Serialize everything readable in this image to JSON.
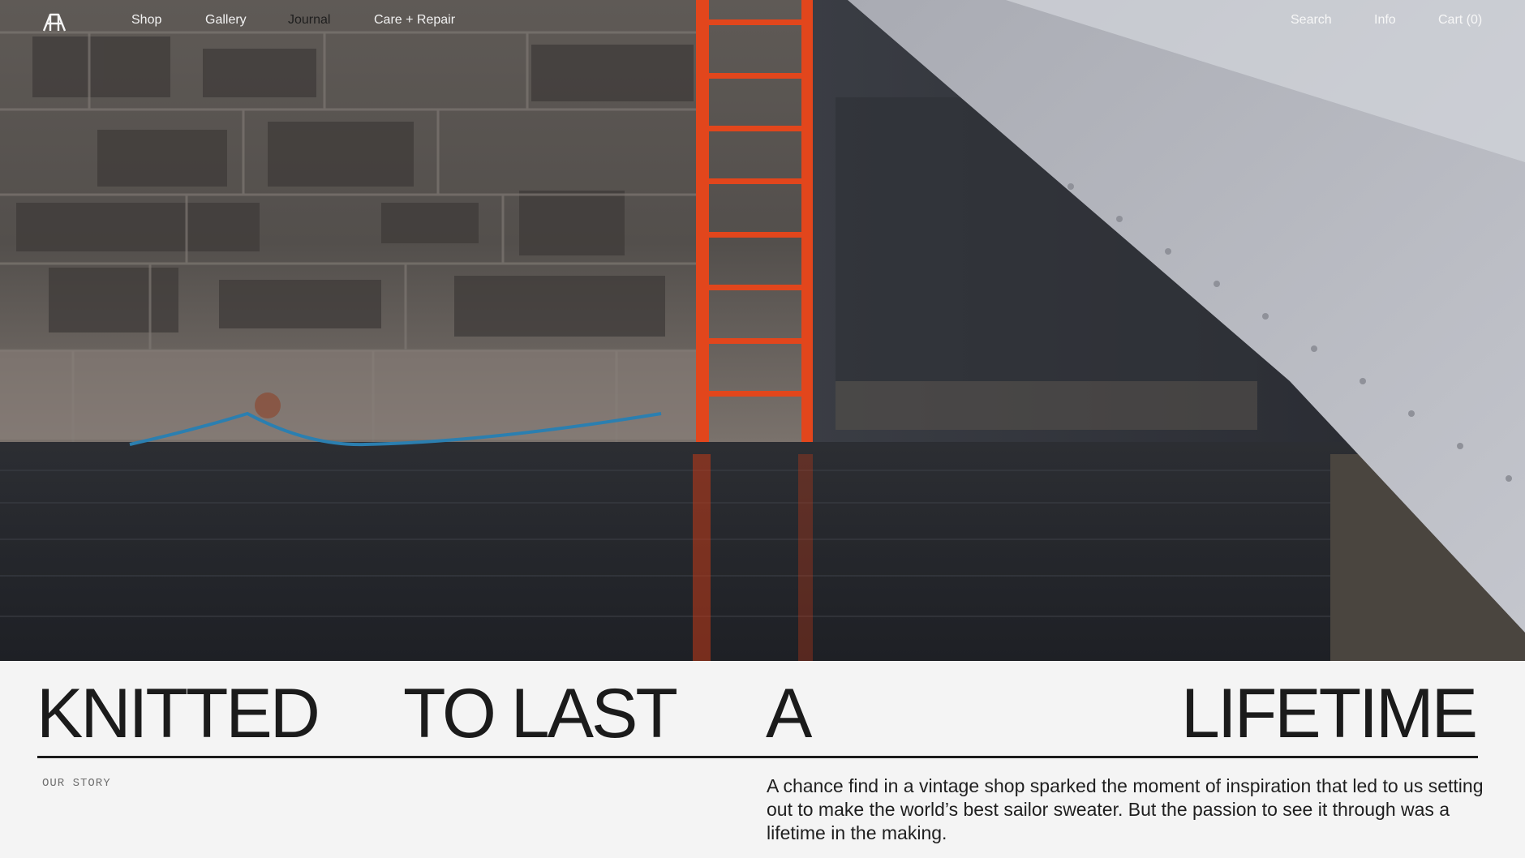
{
  "nav": {
    "logo_icon": "brand-monogram-icon",
    "links_left": [
      "Shop",
      "Gallery",
      "Journal",
      "Care + Repair"
    ],
    "links_right": [
      "Search",
      "Info",
      "Cart (0)"
    ]
  },
  "hero": {
    "ladder_color": "#e2461c",
    "water_color": "#23252b"
  },
  "headline": {
    "words": [
      "KNITTED",
      "TO LAST",
      "A",
      "LIFETIME"
    ]
  },
  "story": {
    "label": "OUR STORY",
    "text": "A chance find in a vintage shop sparked the moment of inspiration that led to us setting out to make the world’s best sailor sweater. But the passion to see it through was a lifetime in the making."
  }
}
